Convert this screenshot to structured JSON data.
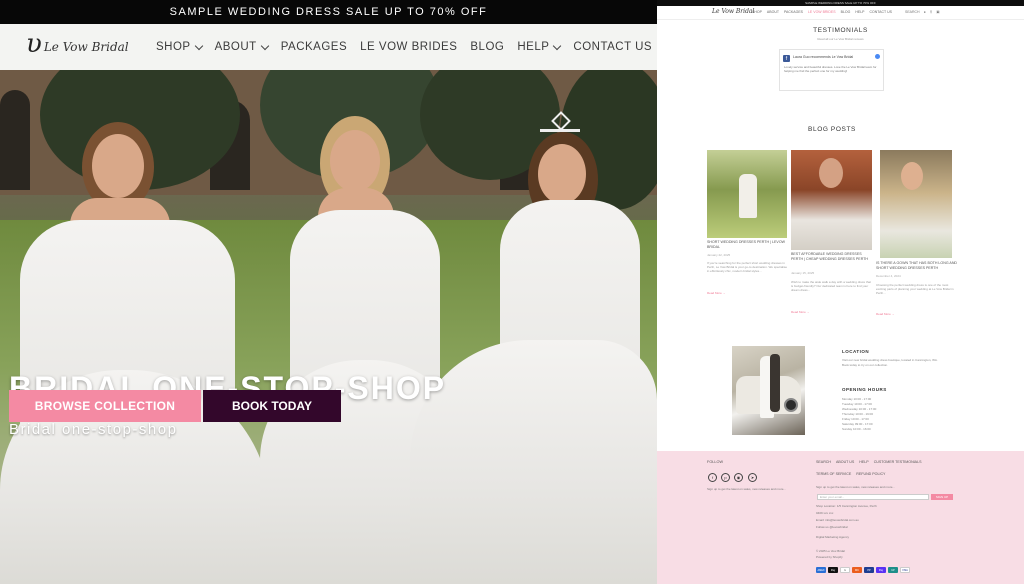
{
  "announcement": "SAMPLE WEDDING DRESS SALE UP TO 70% OFF",
  "logo": {
    "mark": "υ",
    "text": "Le Vow Bridal"
  },
  "nav": {
    "shop": "SHOP",
    "about": "ABOUT",
    "packages": "PACKAGES",
    "le_vow_brides": "LE VOW BRIDES",
    "blog": "BLOG",
    "help": "HELP",
    "contact": "CONTACT US"
  },
  "hero": {
    "title": "BRIDAL ONE-STOP-SHOP",
    "subtitle": "Bridal one-stop-shop",
    "browse_button": "BROWSE COLLECTION",
    "book_button": "BOOK TODAY"
  },
  "colors": {
    "pink": "#f48aa3",
    "plum": "#33072b",
    "footer_bg": "#f8dde5",
    "black": "#070707"
  },
  "thumbnail": {
    "announcement": "SAMPLE WEDDING DRESS SALE UP TO 70% OFF",
    "logo": "Le Vow Bridal",
    "nav": [
      "SHOP",
      "ABOUT",
      "PACKAGES",
      "LE VOW BRIDES",
      "BLOG",
      "HELP",
      "CONTACT US"
    ],
    "search_label": "SEARCH",
    "testimonials_heading": "TESTIMONIALS",
    "testimonials_sub": "Read all our Le Vow Bridal reviews",
    "review": {
      "name": "Laura Guo recommends Le Vow Bridal",
      "text": "Lovely service and beautiful dresses. Love the Le Vow Bridal team for helping me find the perfect one for my wedding!"
    },
    "blog_heading": "BLOG POSTS",
    "posts": [
      {
        "title": "SHORT WEDDING DRESSES PERTH | LEVOW BRIDAL",
        "date": "January 22, 2025",
        "excerpt": "If you're searching for the perfect short wedding dresses in Perth, Le Vow Bridal is your go-to destination. We specialise in effortlessly chic, modern bridal styles...",
        "more": "Read More →"
      },
      {
        "title": "BEST AFFORDABLE WEDDING DRESSES PERTH | CHEAP WEDDING DRESSES PERTH",
        "date": "January 15, 2025",
        "excerpt": "Wish to make the aisle walk a day with a wedding dress that is budget-friendly? Our dedicated team is here to find your dream dress...",
        "more": "Read More →"
      },
      {
        "title": "IS THERE A GOWN THAT HAS BOTH LONG AND SHORT WEDDING DRESSES PERTH",
        "date": "December 4, 2024",
        "excerpt": "Choosing the perfect wedding dress is one of the most exciting parts of planning your wedding at Le Vow Bridal in Perth...",
        "more": "Read More →"
      }
    ],
    "location_heading": "LOCATION",
    "location_text": "Visit our new bridal wedding dress boutique, located in Cannington, WA. Book today to try on our collection.",
    "hours_heading": "OPENING HOURS",
    "hours": [
      "Monday 10:00 - 17:00",
      "Tuesday 10:00 - 17:00",
      "Wednesday 10:00 - 17:00",
      "Thursday 10:00 - 19:00",
      "Friday 10:00 - 17:00",
      "Saturday 09:00 - 17:00",
      "Sunday 10:00 - 16:00"
    ],
    "footer": {
      "follow": "FOLLOW",
      "links1": [
        "SEARCH",
        "ABOUT US",
        "HELP",
        "CUSTOMER TESTIMONIALS"
      ],
      "links2": [
        "TERMS OF SERVICE",
        "REFUND POLICY"
      ],
      "newsletter_text": "Sign up to get the latest on sales, new releases and more...",
      "email_placeholder": "Enter your email...",
      "signup_button": "SIGN UP",
      "shop_location": "Shop Location: 1/5 Cannington Avenue, Perth",
      "phone": "0409 xxx xxx",
      "email_text": "Email: info@levowbridal.com.au",
      "follow_text": "Follow us @levowbridal",
      "agency": "Digital Marketing Agency",
      "copyright": "© 2025 Le Vow Bridal",
      "powered": "Powered by Shopify",
      "payments": [
        "AMEX",
        "Pay",
        "G",
        "MC",
        "PP",
        "Pay",
        "UP",
        "VISA"
      ]
    }
  }
}
